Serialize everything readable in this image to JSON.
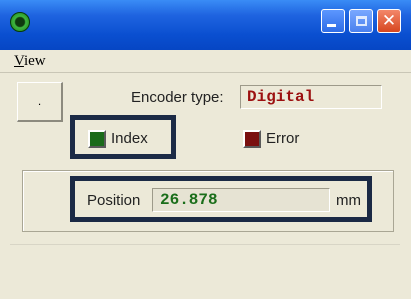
{
  "window": {
    "icon": "app-icon",
    "buttons": {
      "minimize_icon": "minimize-icon",
      "maximize_icon": "maximize-icon",
      "close_icon": "close-icon",
      "close_glyph": "✕"
    }
  },
  "menu": {
    "items": [
      {
        "first": "V",
        "rest": "iew"
      }
    ]
  },
  "controls": {
    "small_button_label": "."
  },
  "encoder": {
    "label": "Encoder type:",
    "value": "Digital",
    "value_color": "#9c1010"
  },
  "indicators": [
    {
      "label": "Index",
      "color": "#1a6a1a"
    },
    {
      "label": "Error",
      "color": "#7a1010"
    }
  ],
  "position": {
    "label": "Position",
    "value": "26.878",
    "unit": "mm",
    "value_color": "#1a6e1a"
  },
  "highlight_color": "#1b2a45"
}
